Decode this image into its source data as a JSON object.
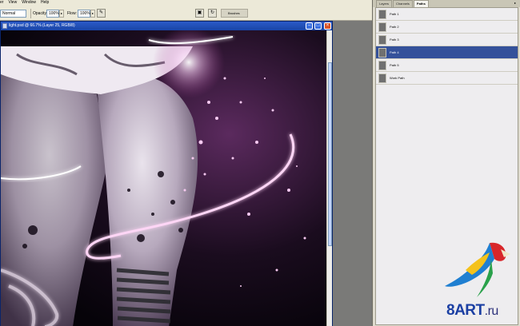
{
  "menubar": {
    "items": [
      "er",
      "View",
      "Window",
      "Help"
    ]
  },
  "options": {
    "mode": "Normal",
    "opacity_label": "Opacity:",
    "opacity_value": "100%",
    "flow_label": "Flow:",
    "flow_value": "100%",
    "brushes_tab": "Brushes"
  },
  "document": {
    "title": "light.psd @ 66.7% (Layer 25, RGB/8)",
    "minimize": "–",
    "maximize": "□",
    "close": "×"
  },
  "panel": {
    "tabs": [
      "Layers",
      "Channels",
      "Paths"
    ],
    "active_tab": "Paths",
    "menu_glyph": "▸",
    "paths": [
      {
        "name": "Path 1",
        "selected": false
      },
      {
        "name": "Path 2",
        "selected": false
      },
      {
        "name": "Path 3",
        "selected": false
      },
      {
        "name": "Path 4",
        "selected": true
      },
      {
        "name": "Path 5",
        "selected": false
      },
      {
        "name": "Work Path",
        "selected": false
      }
    ]
  },
  "watermark": {
    "brand": "8ART",
    "domain": ".ru"
  },
  "colors": {
    "selected_row": "#34519a",
    "titlebar": "#1945a7",
    "glow": "#ff7fe6",
    "watermark_blue": "#1b3fa3"
  }
}
